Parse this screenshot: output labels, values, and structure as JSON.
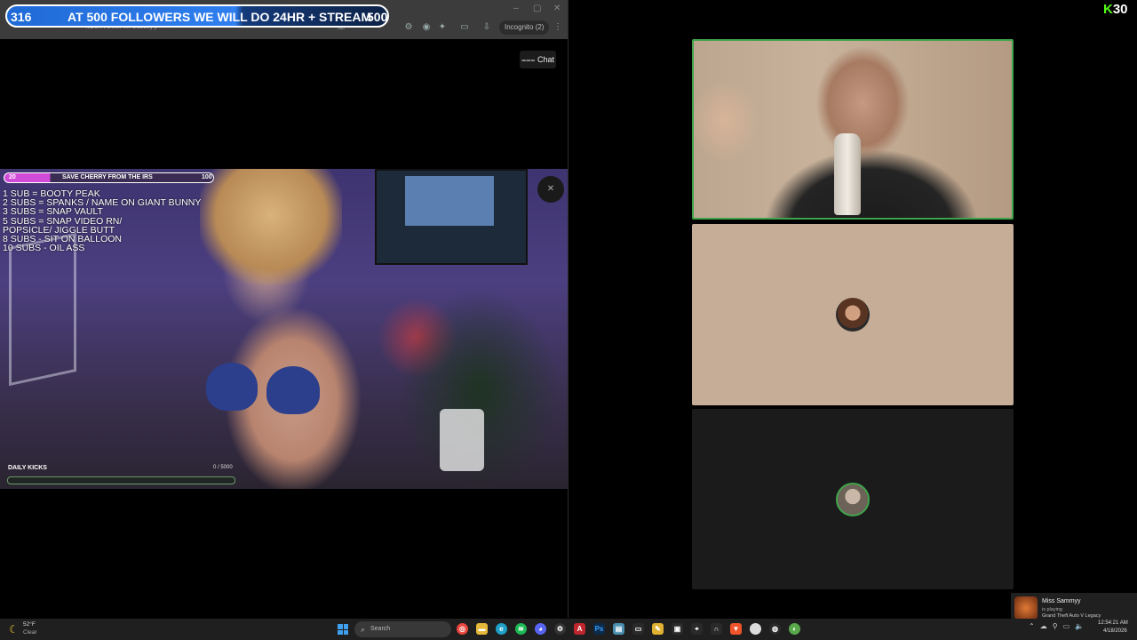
{
  "browser": {
    "url": "kick.com/mrsammyy",
    "incognito_label": "Incognito (2)",
    "window_controls": [
      "–",
      "▢",
      "✕"
    ]
  },
  "follower_goal": {
    "current": "316",
    "text": "AT 500 FOLLOWERS WE WILL DO 24HR + STREAM",
    "target": "500",
    "progress_fraction": 0.632
  },
  "chat_button": {
    "label": "Chat",
    "icon": "chat-lines-icon"
  },
  "stream_overlay": {
    "goal_current": "20",
    "goal_title": "SAVE CHERRY FROM THE IRS",
    "goal_target": "100",
    "goal_fraction": 0.2,
    "sub_menu": [
      "1 SUB =  BOOTY PEAK",
      "2 SUBS = SPANKS / NAME ON GIANT BUNNY",
      "3 SUBS = SNAP VAULT",
      "5 SUBS =  SNAP VIDEO RN/",
      "POPSICLE/ JIGGLE BUTT",
      "8 SUBS - SIT ON BALLOON",
      "10 SUBS - OIL ASS"
    ],
    "daily_kicks_label": "DAILY KICKS",
    "daily_kicks_count": "0 / 5000",
    "daily_kicks_fraction": 0.0
  },
  "kick_badge": {
    "letter": "K",
    "count": "30",
    "color": "#53fc18"
  },
  "call_tiles": [
    {
      "type": "video",
      "speaking": true
    },
    {
      "type": "avatar",
      "avatar": "bearded-man-avatar"
    },
    {
      "type": "avatar",
      "avatar": "man-avatar",
      "speaking": true
    }
  ],
  "notification": {
    "name": "Miss Sammyy",
    "status": "is playing",
    "game": "Grand Theft Auto V Legacy"
  },
  "taskbar": {
    "weather_temp": "52°F",
    "weather_cond": "Clear",
    "search_placeholder": "Search",
    "clock_time": "12:54:21 AM",
    "clock_date": "4/18/2026",
    "apps": [
      "chrome",
      "file-explorer",
      "edge",
      "spotify",
      "discord",
      "steam",
      "adobe",
      "photoshop",
      "notepad",
      "terminal",
      "notes",
      "obs",
      "app",
      "headset",
      "brave",
      "app2",
      "app3",
      "app4"
    ]
  },
  "colors": {
    "banner_blue": "#2f7ff0",
    "goal_pink": "#d14bd8",
    "speaking_green": "#3fa44a",
    "kick_green": "#53fc18"
  }
}
